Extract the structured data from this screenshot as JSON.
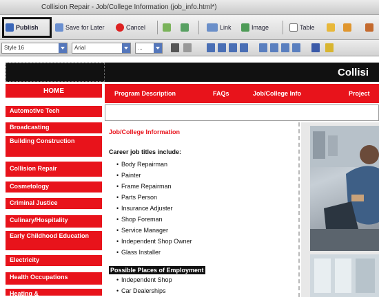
{
  "window": {
    "title": "Collision Repair - Job/College Information (job_info.html*)"
  },
  "toolbar": {
    "publish_label": "Publish",
    "save_later_label": "Save for Later",
    "cancel_label": "Cancel",
    "link_label": "Link",
    "image_label": "Image",
    "table_label": "Table"
  },
  "format_bar": {
    "style_value": "Style 16",
    "font_value": "Arial",
    "size_value": "..."
  },
  "page": {
    "site_title": "Collisi",
    "home_label": "HOME",
    "sidebar": [
      "Automotive Tech",
      "Broadcasting",
      "Building Construction",
      "Collision Repair",
      "Cosmetology",
      "Criminal Justice",
      "Culinary/Hospitality",
      "Early Childhood Education",
      "Electricity",
      "Health Occupations",
      "Heating &"
    ],
    "topnav": [
      "Program Description",
      "FAQs",
      "Job/College Info",
      "Project"
    ],
    "section_title": "Job/College Information",
    "jobs_heading": "Career job titles include:",
    "jobs": [
      "Body Repairman",
      "Painter",
      "Frame Repairman",
      "Parts Person",
      "Insurance Adjuster",
      "Shop Foreman",
      "Service Manager",
      "Independent Shop Owner",
      "Glass Installer"
    ],
    "places_heading": "Possible Places of Employment",
    "places": [
      "Independent Shop",
      "Car Dealerships"
    ]
  },
  "colors": {
    "accent_red": "#e8131b",
    "banner": "#111111"
  }
}
